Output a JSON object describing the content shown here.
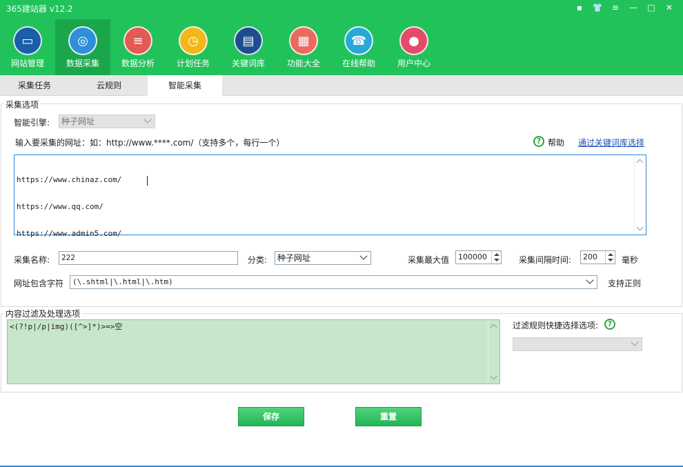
{
  "app": {
    "title": "365建站器 v12.2"
  },
  "window_controls": [
    "▪",
    "👕",
    "≡",
    "—",
    "□",
    "✕"
  ],
  "toolbar": [
    {
      "label": "网站管理",
      "icon": "monitor-icon",
      "glyph": "▭",
      "color": "#1a5ea8"
    },
    {
      "label": "数据采集",
      "icon": "globe-icon",
      "glyph": "◎",
      "color": "#2f8fd8"
    },
    {
      "label": "数据分析",
      "icon": "database-icon",
      "glyph": "≡",
      "color": "#e35a52"
    },
    {
      "label": "计划任务",
      "icon": "gauge-icon",
      "glyph": "◷",
      "color": "#f2b71b"
    },
    {
      "label": "关键词库",
      "icon": "book-icon",
      "glyph": "▤",
      "color": "#1d4e8f"
    },
    {
      "label": "功能大全",
      "icon": "grid-icon",
      "glyph": "▦",
      "color": "#ea6a5c"
    },
    {
      "label": "在线帮助",
      "icon": "headset-icon",
      "glyph": "☎",
      "color": "#27a9d6"
    },
    {
      "label": "用户中心",
      "icon": "user-icon",
      "glyph": "●",
      "color": "#e14c6a"
    }
  ],
  "tabs": [
    "采集任务",
    "云规则",
    "智能采集"
  ],
  "options": {
    "group_title": "采集选项",
    "engine_label": "智能引擎:",
    "engine_value": "种子网址",
    "url_prompt": "输入要采集的网址：如：http://www.****.com/（支持多个，每行一个）",
    "help_label": "帮助",
    "keyword_link": "通过关键词库选择",
    "urls": [
      "https://www.chinaz.com/",
      "https://www.qq.com/",
      "https://www.admin5.com/"
    ],
    "name_label": "采集名称:",
    "name_value": "222",
    "category_label": "分类:",
    "category_value": "种子网址",
    "max_label": "采集最大值",
    "max_value": "100000",
    "interval_label": "采集间隔时间:",
    "interval_value": "200",
    "interval_unit": "毫秒",
    "contains_label": "网址包含字符",
    "contains_value": "(\\.shtml|\\.html|\\.htm)",
    "regex_label": "支持正则"
  },
  "filter": {
    "group_title": "内容过滤及处理选项",
    "rule_text": "<(?!p|/p|img)([^>]*)>=>空",
    "quick_label": "过滤规则快捷选择选项:",
    "quick_value": ""
  },
  "actions": {
    "save": "保存",
    "reset": "重置"
  }
}
